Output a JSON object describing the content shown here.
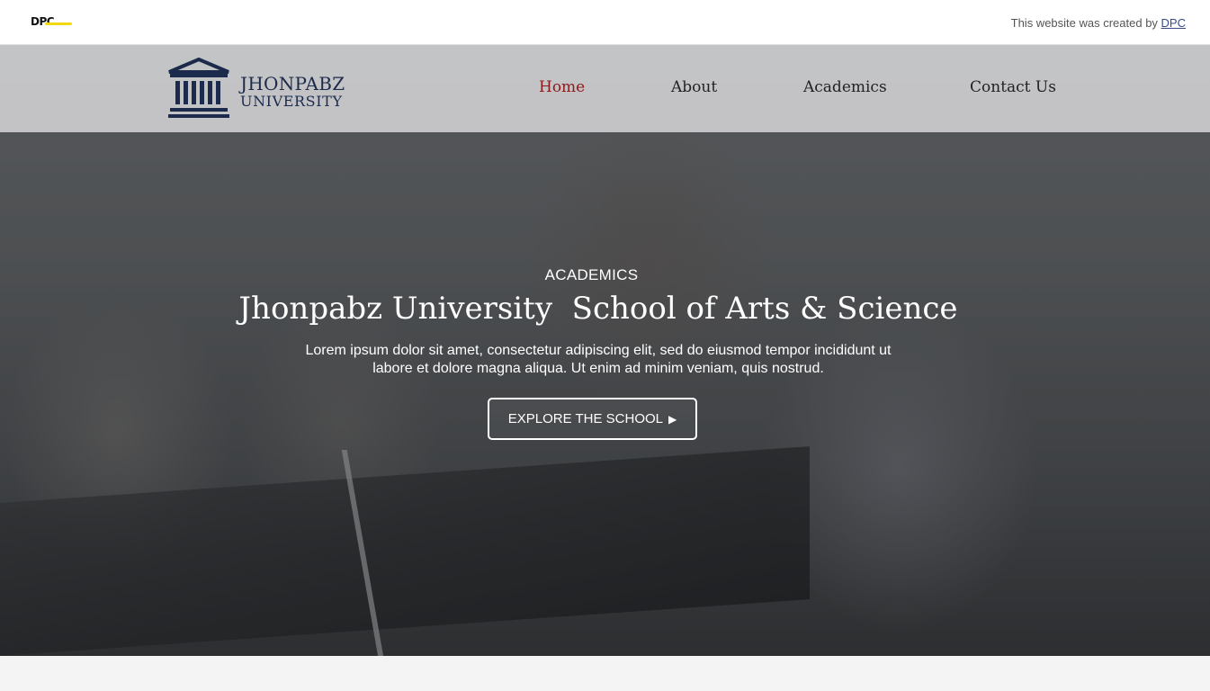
{
  "topbar": {
    "brand_mark": "DPC",
    "credit_text": "This website was created by ",
    "credit_link": "DPC"
  },
  "nav": {
    "logo": {
      "line1": "JHONPABZ",
      "line2": "UNIVERSITY"
    },
    "items": [
      {
        "label": "Home",
        "active": true
      },
      {
        "label": "About",
        "active": false
      },
      {
        "label": "Academics",
        "active": false
      },
      {
        "label": "Contact Us",
        "active": false
      }
    ]
  },
  "hero": {
    "kicker": "ACADEMICS",
    "title": "Jhonpabz University  School of Arts & Science",
    "description": "Lorem ipsum dolor sit amet, consectetur adipiscing elit, sed do eiusmod tempor incididunt ut labore et dolore magna aliqua. Ut enim ad minim veniam, quis nostrud.",
    "button_label": "EXPLORE THE SCHOOL",
    "button_icon": "play-arrow-icon"
  },
  "colors": {
    "nav_active": "#8c1a1a",
    "logo_navy": "#1c2b4b",
    "brand_yellow": "#f2d90f"
  }
}
